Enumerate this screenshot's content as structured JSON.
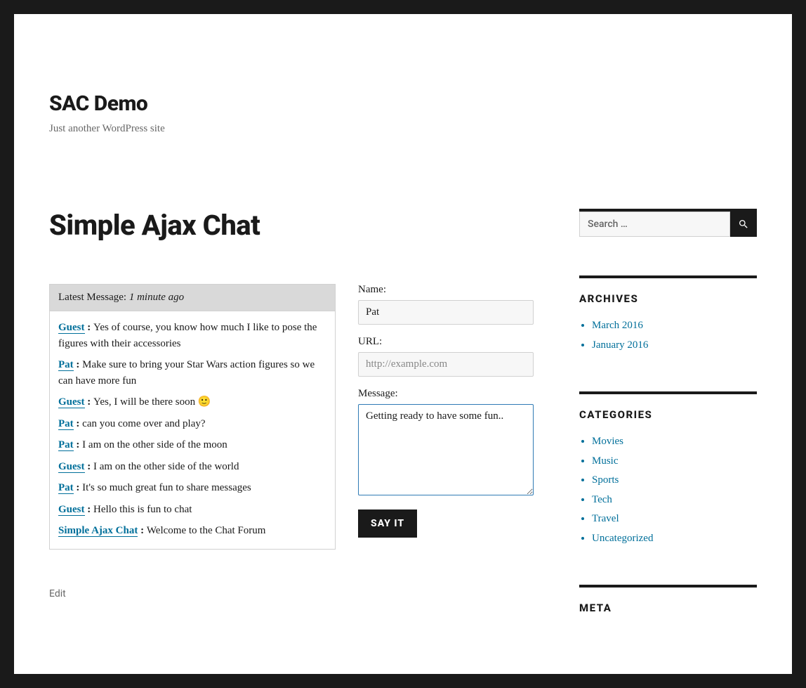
{
  "site": {
    "title": "SAC Demo",
    "tagline": "Just another WordPress site"
  },
  "page": {
    "title": "Simple Ajax Chat",
    "edit_label": "Edit"
  },
  "chat": {
    "latest_prefix": "Latest Message: ",
    "latest_time": "1 minute ago",
    "messages": [
      {
        "user": "Guest",
        "text": "Yes of course, you know how much I like to pose the figures with their accessories"
      },
      {
        "user": "Pat",
        "text": "Make sure to bring your Star Wars action figures so we can have more fun"
      },
      {
        "user": "Guest",
        "text": "Yes, I will be there soon 🙂"
      },
      {
        "user": "Pat",
        "text": "can you come over and play?"
      },
      {
        "user": "Pat",
        "text": "I am on the other side of the moon"
      },
      {
        "user": "Guest",
        "text": "I am on the other side of the world"
      },
      {
        "user": "Pat",
        "text": "It's so much great fun to share messages"
      },
      {
        "user": "Guest",
        "text": "Hello this is fun to chat"
      },
      {
        "user": "Simple Ajax Chat",
        "text": "Welcome to the Chat Forum"
      }
    ]
  },
  "form": {
    "name_label": "Name:",
    "name_value": "Pat",
    "url_label": "URL:",
    "url_placeholder": "http://example.com",
    "message_label": "Message:",
    "message_value": "Getting ready to have some fun..",
    "submit_label": "Say It"
  },
  "sidebar": {
    "search_placeholder": "Search …",
    "archives_title": "ARCHIVES",
    "archives": [
      "March 2016",
      "January 2016"
    ],
    "categories_title": "CATEGORIES",
    "categories": [
      "Movies",
      "Music",
      "Sports",
      "Tech",
      "Travel",
      "Uncategorized"
    ],
    "meta_title": "META"
  }
}
